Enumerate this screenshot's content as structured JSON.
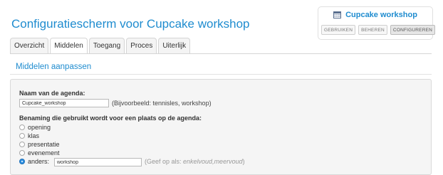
{
  "page": {
    "title": "Configuratiescherm voor Cupcake workshop"
  },
  "header_card": {
    "title": "Cupcake workshop",
    "icon": "calendar-icon",
    "buttons": [
      "GEBRUIKEN",
      "BEHEREN",
      "CONFIGUREREN"
    ],
    "active_button": "CONFIGUREREN"
  },
  "tabs": [
    "Overzicht",
    "Middelen",
    "Toegang",
    "Proces",
    "Uiterlijk"
  ],
  "active_tab": "Middelen",
  "section": {
    "title": "Middelen aanpassen"
  },
  "form": {
    "name_label": "Naam van de agenda:",
    "name_value": "Cupcake_workshop",
    "name_hint": "(Bijvoorbeeld: tennisles, workshop)",
    "place_label": "Benaming die gebruikt wordt voor een plaats op de agenda:",
    "options": [
      "opening",
      "klas",
      "presentatie",
      "evenement",
      "anders:"
    ],
    "selected_option": "anders:",
    "other_value": "workshop",
    "other_hint_prefix": "(Geef op als: ",
    "other_hint_format": "enkelvoud,meervoud",
    "other_hint_suffix": ")"
  },
  "colors": {
    "accent": "#1f8ccf",
    "panel_bg": "#f5f5f5",
    "radio_selected": "#2d8fe0"
  }
}
